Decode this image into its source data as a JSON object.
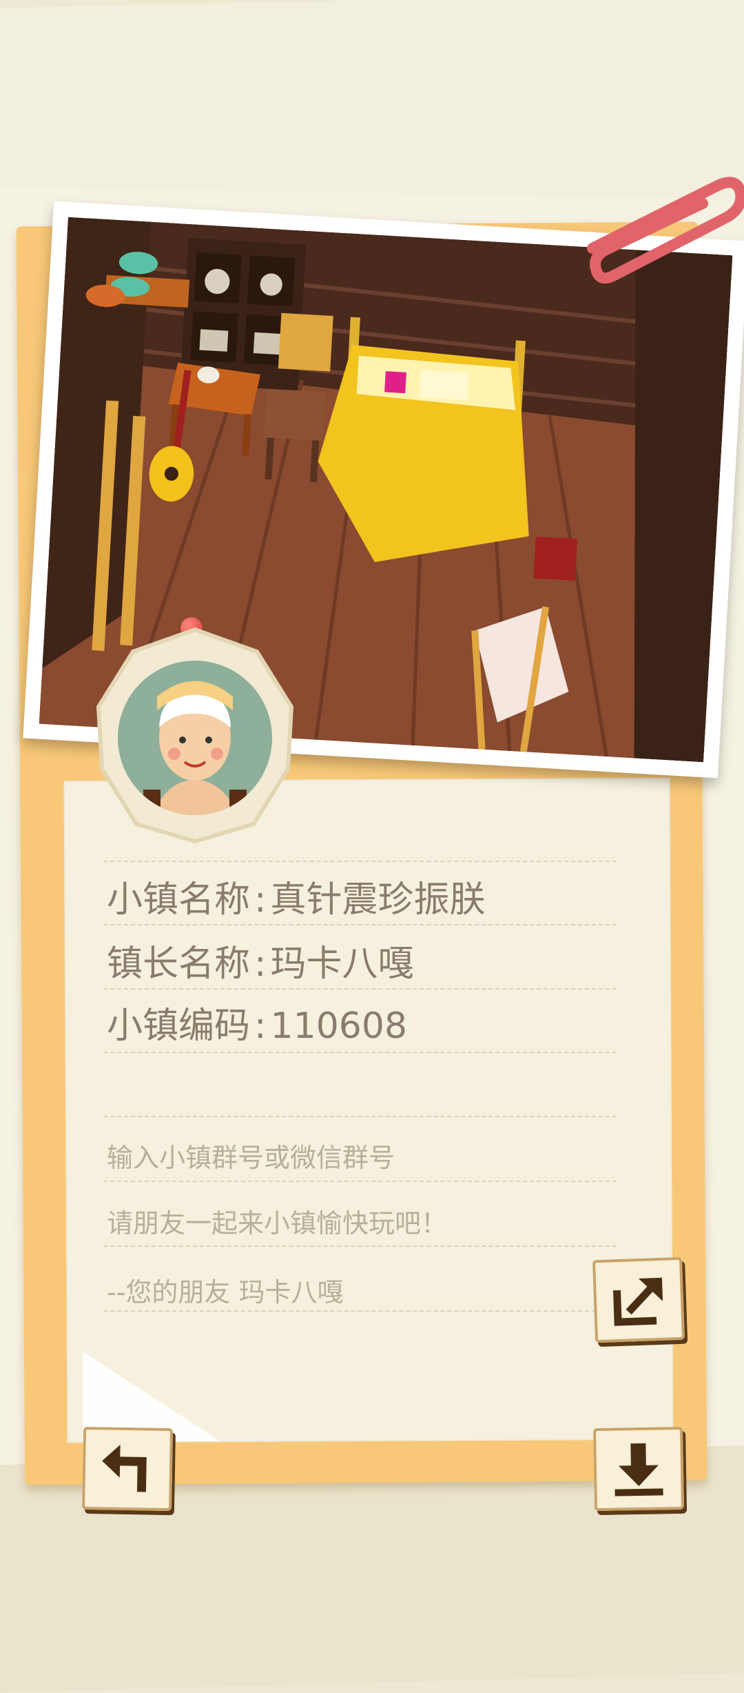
{
  "town": {
    "name_label": "小镇名称",
    "name_value": "真针震珍振朕",
    "mayor_label": "镇长名称",
    "mayor_value": "玛卡八嘎",
    "code_label": "小镇编码",
    "code_value": "110608",
    "colon": ":"
  },
  "invite": {
    "line1": "输入小镇群号或微信群号",
    "line2": "请朋友一起来小镇愉快玩吧！",
    "line3": "--您的朋友 玛卡八嘎"
  },
  "icons": {
    "share": "share-icon",
    "back": "back-arrow-icon",
    "download": "download-icon",
    "clip": "paperclip-icon"
  },
  "colors": {
    "card": "#f8c878",
    "text": "#8a7c6c",
    "muted": "#b8ae9c",
    "button_ink": "#4a2e14"
  }
}
